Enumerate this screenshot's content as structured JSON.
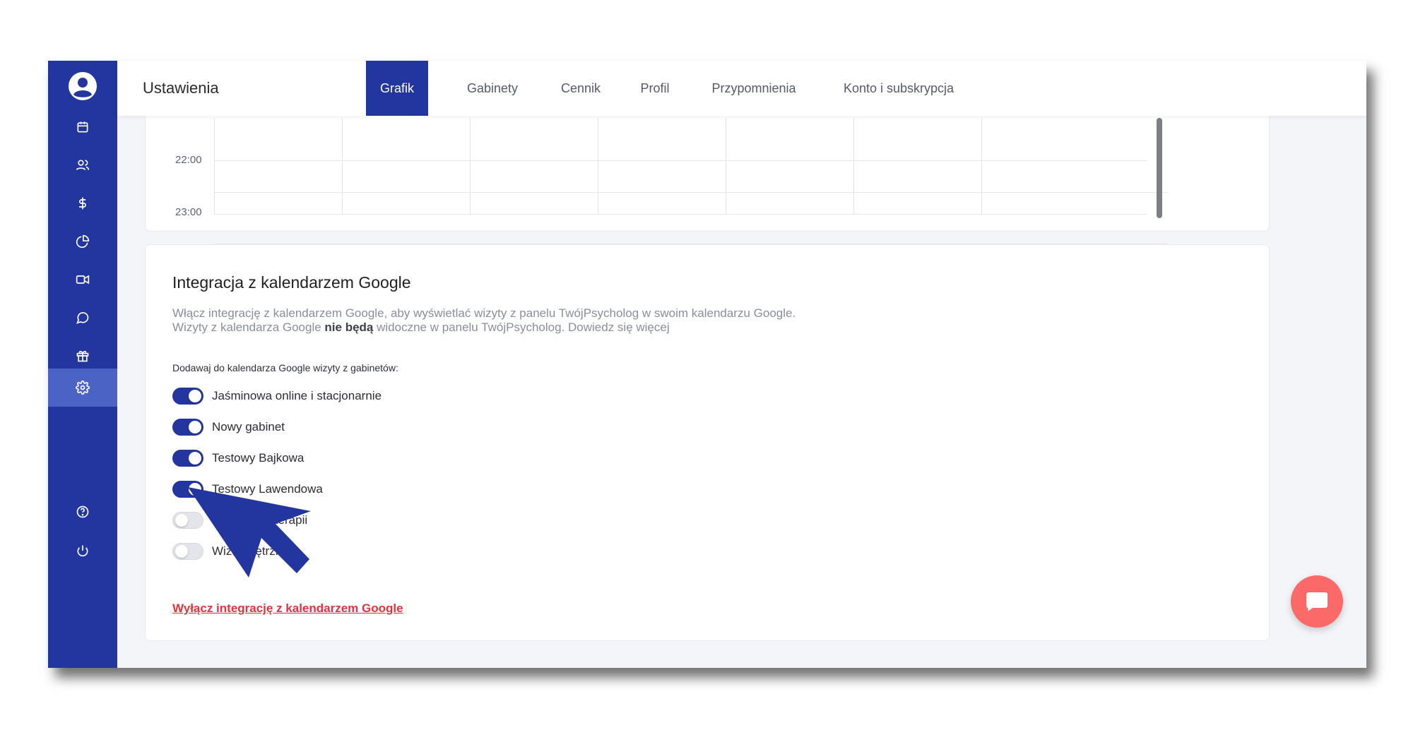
{
  "header": {
    "title": "Ustawienia",
    "tabs": [
      {
        "label": "Grafik",
        "active": true
      },
      {
        "label": "Gabinety",
        "active": false
      },
      {
        "label": "Cennik",
        "active": false
      },
      {
        "label": "Profil",
        "active": false
      },
      {
        "label": "Przypomnienia",
        "active": false
      },
      {
        "label": "Konto i subskrypcja",
        "active": false
      }
    ]
  },
  "sidebar": {
    "items": [
      {
        "icon": "calendar-icon"
      },
      {
        "icon": "users-icon"
      },
      {
        "icon": "dollar-icon"
      },
      {
        "icon": "pie-chart-icon"
      },
      {
        "icon": "video-icon"
      },
      {
        "icon": "chat-icon"
      },
      {
        "icon": "gift-icon"
      },
      {
        "icon": "gear-icon",
        "active": true
      },
      {
        "icon": "help-icon"
      },
      {
        "icon": "power-icon"
      }
    ],
    "accent": "#2336a0",
    "active_bg": "#4a63c4"
  },
  "schedule": {
    "times": [
      "22:00",
      "23:00"
    ]
  },
  "integration": {
    "title": "Integracja z kalendarzem Google",
    "desc_line1": "Włącz integrację z kalendarzem Google, aby wyświetlać wizyty z panelu TwójPsycholog w swoim kalendarzu Google.",
    "desc_line2_pre": "Wizyty z kalendarza Google ",
    "desc_line2_bold": "nie będą",
    "desc_line2_post": " widoczne w panelu TwójPsycholog. Dowiedz się więcej",
    "subhead": "Dodawaj do kalendarza Google wizyty z gabinetów:",
    "offices": [
      {
        "label": "Jaśminowa online i stacjonarnie",
        "enabled": true
      },
      {
        "label": "Nowy gabinet",
        "enabled": true
      },
      {
        "label": "Testowy Bajkowa",
        "enabled": true
      },
      {
        "label": "Testowy Lawendowa",
        "enabled": true
      },
      {
        "label": "...et Psychoterapii",
        "enabled": false
      },
      {
        "label": "Wiz... ...ętrzne",
        "enabled": false
      }
    ],
    "disable_link": "Wyłącz integrację z kalendarzem Google"
  },
  "colors": {
    "primary": "#2336a0",
    "danger": "#e0343c",
    "chat": "#fb6a68"
  }
}
